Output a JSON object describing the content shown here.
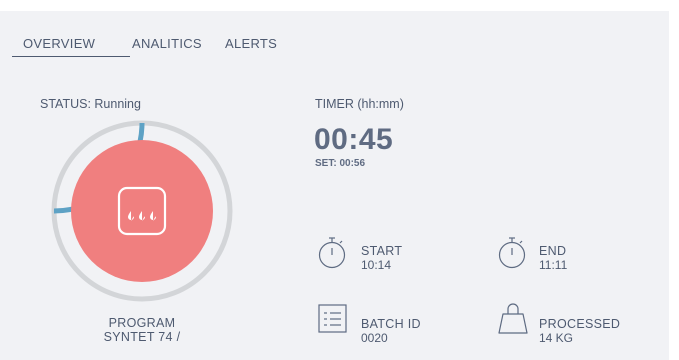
{
  "tabs": [
    {
      "label": "OVERVIEW",
      "active": true
    },
    {
      "label": "ANALITICS",
      "active": false
    },
    {
      "label": "ALERTS",
      "active": false
    }
  ],
  "status": {
    "label": "STATUS: Running"
  },
  "timer": {
    "label": "TIMER (hh:mm)",
    "value": "00:45",
    "set": "SET: 00:56"
  },
  "program": {
    "line1": "PROGRAM",
    "line2": "SYNTET 74 /"
  },
  "progress": {
    "fraction": 0.25
  },
  "info": {
    "start": {
      "title": "START",
      "value": "10:14",
      "icon": "stopwatch-icon"
    },
    "end": {
      "title": "END",
      "value": "11:11",
      "icon": "stopwatch-icon"
    },
    "batch": {
      "title": "BATCH ID",
      "value": "0020",
      "icon": "list-icon"
    },
    "processed": {
      "title": "PROCESSED",
      "value": "14 KG",
      "icon": "weight-icon"
    }
  },
  "colors": {
    "accent": "#f07f7f",
    "progress": "#5ea2c5",
    "ring_track": "#d3d5d8",
    "text": "#4e5a70",
    "background": "#f1f2f5"
  }
}
